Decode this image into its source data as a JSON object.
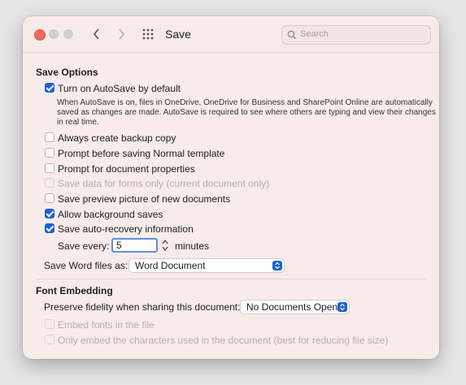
{
  "window": {
    "title": "Save",
    "search_placeholder": "Search"
  },
  "save_options": {
    "heading": "Save Options",
    "autosave_label": "Turn on AutoSave by default",
    "autosave_desc": "When AutoSave is on, files in OneDrive, OneDrive for Business and SharePoint Online are automatically saved as changes are made. AutoSave is required to see where others are typing and view their changes in real time.",
    "backup_label": "Always create backup copy",
    "prompt_normal_label": "Prompt before saving Normal template",
    "prompt_props_label": "Prompt for document properties",
    "forms_label": "Save data for forms only (current document only)",
    "preview_label": "Save preview picture of new documents",
    "background_label": "Allow background saves",
    "autorecover_label": "Save auto-recovery information",
    "save_every_label": "Save every:",
    "save_every_value": "5",
    "minutes_label": "minutes",
    "save_as_label": "Save Word files as:",
    "save_as_value": "Word Document"
  },
  "font_embedding": {
    "heading": "Font Embedding",
    "fidelity_label": "Preserve fidelity when sharing this document:",
    "fidelity_value": "No Documents Open",
    "embed_label": "Embed fonts in the file",
    "embed_chars_label": "Only embed the characters used in the document (best for reducing file size)"
  },
  "colors": {
    "accent": "#1e5fd4",
    "close": "#ee6a5e"
  }
}
